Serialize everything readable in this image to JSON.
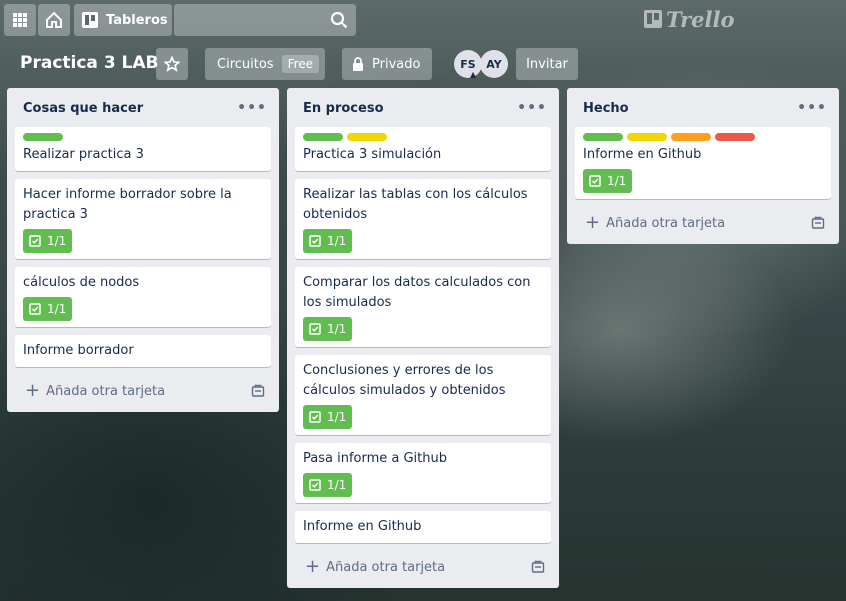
{
  "topbar": {
    "boards_label": "Tableros",
    "logo_text": "Trello"
  },
  "board": {
    "title": "Practica 3 LAB",
    "team_label": "Circuitos",
    "team_badge": "Free",
    "visibility_label": "Privado",
    "members": [
      "FS",
      "AY"
    ],
    "invite_label": "Invitar"
  },
  "colors": {
    "green": "#61bd4f",
    "yellow": "#f2d600",
    "orange": "#ff9f1a",
    "red": "#eb5a46"
  },
  "lists": [
    {
      "title": "Cosas que hacer",
      "menu_icon": "ellipsis-icon",
      "add_label": "Añada otra tarjeta",
      "cards": [
        {
          "labels": [
            "green"
          ],
          "text": "Realizar practica 3",
          "badge": ""
        },
        {
          "labels": [],
          "text": "Hacer informe borrador sobre la practica 3",
          "badge": "1/1"
        },
        {
          "labels": [],
          "text": "cálculos de nodos",
          "badge": "1/1"
        },
        {
          "labels": [],
          "text": "Informe borrador",
          "badge": ""
        }
      ]
    },
    {
      "title": "En proceso",
      "menu_icon": "ellipsis-icon",
      "add_label": "Añada otra tarjeta",
      "cards": [
        {
          "labels": [
            "green",
            "yellow"
          ],
          "text": "Practica 3 simulación",
          "badge": ""
        },
        {
          "labels": [],
          "text": "Realizar las tablas con los cálculos obtenidos",
          "badge": "1/1"
        },
        {
          "labels": [],
          "text": "Comparar los datos calculados con los simulados",
          "badge": "1/1"
        },
        {
          "labels": [],
          "text": "Conclusiones y errores de los cálculos simulados y obtenidos",
          "badge": "1/1"
        },
        {
          "labels": [],
          "text": "Pasa informe a Github",
          "badge": "1/1"
        },
        {
          "labels": [],
          "text": "Informe en Github",
          "badge": ""
        }
      ]
    },
    {
      "title": "Hecho",
      "menu_icon": "ellipsis-icon",
      "add_label": "Añada otra tarjeta",
      "cards": [
        {
          "labels": [
            "green",
            "yellow",
            "orange",
            "red"
          ],
          "text": "Informe en Github",
          "badge": "1/1"
        }
      ]
    }
  ]
}
